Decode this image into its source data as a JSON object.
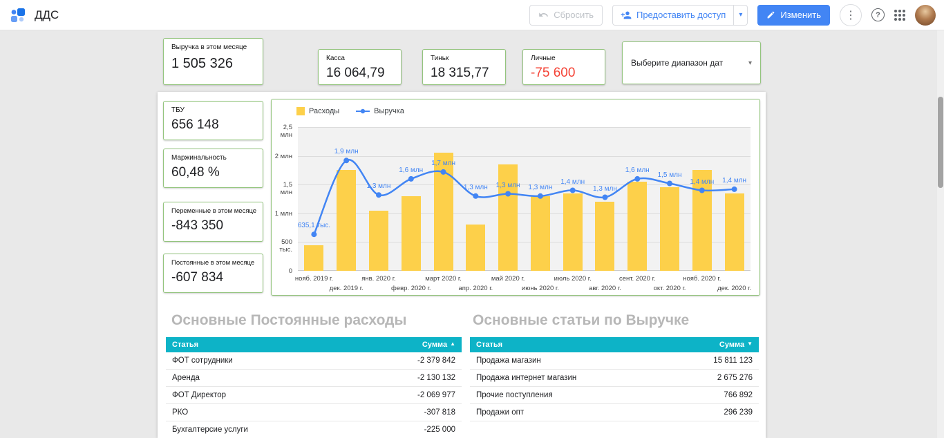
{
  "theme": {
    "accent_green": "#93c47d",
    "accent_blue": "#4285f4",
    "bar_yellow": "#fdd04a",
    "table_header_teal": "#0db3c7",
    "negative_red": "#f44336",
    "title_gray": "#b7b7b7"
  },
  "icons": {
    "help_glyph": "?",
    "more_vert_glyph": "⋮",
    "caret_glyph": "▾"
  },
  "header": {
    "app_title": "ДДС",
    "reset_button": "Сбросить",
    "share_button": "Предоставить доступ",
    "edit_button": "Изменить"
  },
  "top_cards": [
    {
      "label": "Выручка в этом месяце",
      "value": "1 505 326"
    },
    {
      "label": "Касса",
      "value": "16 064,79"
    },
    {
      "label": "Тиньк",
      "value": "18 315,77"
    },
    {
      "label": "Личные",
      "value": "-75 600"
    }
  ],
  "date_picker": {
    "label": "Выберите диапазон дат",
    "caret": "▾"
  },
  "left_cards": [
    {
      "label": "ТБУ",
      "value": "656 148"
    },
    {
      "label": "Маржинальность",
      "value": "60,48 %"
    },
    {
      "label": "Переменные в этом месяце",
      "value": "-843 350"
    },
    {
      "label": "Постоянные в этом месяце",
      "value": "-607 834"
    }
  ],
  "chart_data": {
    "type": "combo",
    "title": "",
    "grid": true,
    "legend_position": "top-left",
    "ylim_mln": [
      0,
      2.5
    ],
    "y_ticks": [
      "0",
      "500 тыс.",
      "1 млн",
      "1,5 млн",
      "2 млн",
      "2,5 млн"
    ],
    "x": [
      "нояб. 2019 г.",
      "дек. 2019 г.",
      "янв. 2020 г.",
      "февр. 2020 г.",
      "март 2020 г.",
      "апр. 2020 г.",
      "май 2020 г.",
      "июнь 2020 г.",
      "июль 2020 г.",
      "авг. 2020 г.",
      "сент. 2020 г.",
      "окт. 2020 г.",
      "нояб. 2020 г.",
      "дек. 2020 г."
    ],
    "series": [
      {
        "name": "Расходы",
        "type": "bar",
        "color": "#fdd04a",
        "values_mln": [
          0.45,
          1.75,
          1.05,
          1.3,
          2.05,
          0.8,
          1.85,
          1.3,
          1.35,
          1.2,
          1.55,
          1.45,
          1.75,
          1.35
        ]
      },
      {
        "name": "Выручка",
        "type": "line",
        "color": "#4285f4",
        "values_mln": [
          0.6351,
          1.92,
          1.32,
          1.6,
          1.72,
          1.3,
          1.34,
          1.3,
          1.4,
          1.28,
          1.6,
          1.52,
          1.4,
          1.42
        ],
        "point_labels": [
          "635,1 тыс.",
          "1,9 млн",
          "1,3 млн",
          "1,6 млн",
          "1,7 млн",
          "1,3 млн",
          "1,3 млн",
          "1,3 млн",
          "1,4 млн",
          "1,3 млн",
          "1,6 млн",
          "1,5 млн",
          "1,4 млн",
          "1,4 млн"
        ]
      }
    ]
  },
  "tables": [
    {
      "title": "Основные Постоянные расходы",
      "columns": [
        "Статья",
        "Сумма"
      ],
      "sort_icon": "▲",
      "rows": [
        [
          "ФОТ сотрудники",
          "-2 379 842"
        ],
        [
          "Аренда",
          "-2 130 132"
        ],
        [
          "ФОТ Директор",
          "-2 069 977"
        ],
        [
          "РКО",
          "-307 818"
        ],
        [
          "Бухгалтерсие услуги",
          "-225 000"
        ]
      ]
    },
    {
      "title": "Основные статьи по Выручке",
      "columns": [
        "Статья",
        "Сумма"
      ],
      "sort_icon": "▼",
      "rows": [
        [
          "Продажа магазин",
          "15 811 123"
        ],
        [
          "Продажа интернет магазин",
          "2 675 276"
        ],
        [
          "Прочие поступления",
          "766 892"
        ],
        [
          "Продажи опт",
          "296 239"
        ]
      ]
    }
  ]
}
